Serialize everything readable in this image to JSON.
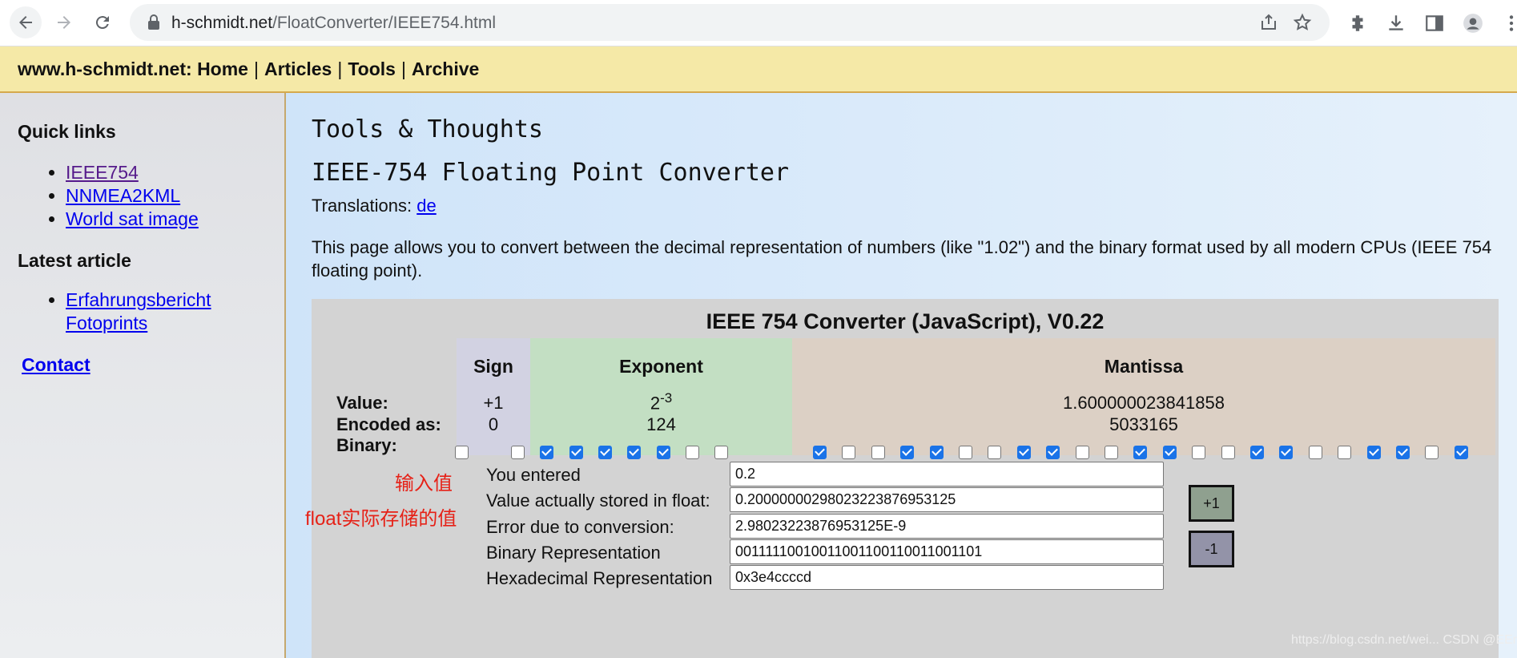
{
  "browser": {
    "url_domain": "h-schmidt.net",
    "url_path": "/FloatConverter/IEEE754.html",
    "icons": [
      "back-icon",
      "forward-icon",
      "reload-icon",
      "lock-icon",
      "share-icon",
      "star-icon",
      "extensions-icon",
      "download-icon",
      "sidepanel-icon",
      "profile-icon",
      "more-icon"
    ]
  },
  "menubar": {
    "site": "www.h-schmidt.net",
    "colon": ":",
    "home": "Home",
    "articles": "Articles",
    "tools": "Tools",
    "archive": "Archive",
    "sep": "|"
  },
  "sidebar": {
    "quick_links_heading": "Quick links",
    "quick_links": [
      "IEEE754",
      "NNMEA2KML",
      "World sat image"
    ],
    "latest_heading": "Latest article",
    "latest_line1": "Erfahrungsbericht",
    "latest_line2": "Fotoprints",
    "contact": "Contact"
  },
  "main": {
    "site_title": "Tools & Thoughts",
    "page_title": "IEEE-754 Floating Point Converter",
    "translations_label": "Translations: ",
    "translations_link": "de",
    "intro": "This page allows you to convert between the decimal representation of numbers (like \"1.02\") and the binary format used by all modern CPUs (IEEE 754 floating point)."
  },
  "converter": {
    "title": "IEEE 754 Converter (JavaScript), V0.22",
    "headers": {
      "sign": "Sign",
      "exponent": "Exponent",
      "mantissa": "Mantissa"
    },
    "row_labels": {
      "value": "Value:",
      "encoded": "Encoded as:",
      "binary": "Binary:"
    },
    "values": {
      "sign": "+1",
      "exponent_base": "2",
      "exponent_power": "-3",
      "mantissa": "1.600000023841858"
    },
    "encoded": {
      "sign": "0",
      "exponent": "124",
      "mantissa": "5033165"
    },
    "bits": {
      "sign": [
        0
      ],
      "exponent": [
        0,
        1,
        1,
        1,
        1,
        1,
        0,
        0
      ],
      "mantissa": [
        1,
        0,
        0,
        1,
        1,
        0,
        0,
        1,
        1,
        0,
        0,
        1,
        1,
        0,
        0,
        1,
        1,
        0,
        0,
        1,
        1,
        0,
        1
      ]
    },
    "fields": {
      "you_entered_label": "You entered",
      "you_entered": "0.2",
      "stored_label": "Value actually stored in float:",
      "stored": "0.20000000298023223876953125",
      "error_label": "Error due to conversion:",
      "error": "2.98023223876953125E-9",
      "binary_label": "Binary Representation",
      "binary": "00111110010011001100110011001101",
      "hex_label": "Hexadecimal Representation",
      "hex": "0x3e4ccccd"
    },
    "plus_label": "+1",
    "minus_label": "-1"
  },
  "annotations": {
    "input_value": "输入值",
    "stored_value": "float实际存储的值"
  },
  "watermark": "https://blog.csdn.net/wei... CSDN @EEr...",
  "colors": {
    "annotation": "#e62117",
    "checkbox_on": "#1a73e8",
    "menubar": "#f5e9a7"
  }
}
